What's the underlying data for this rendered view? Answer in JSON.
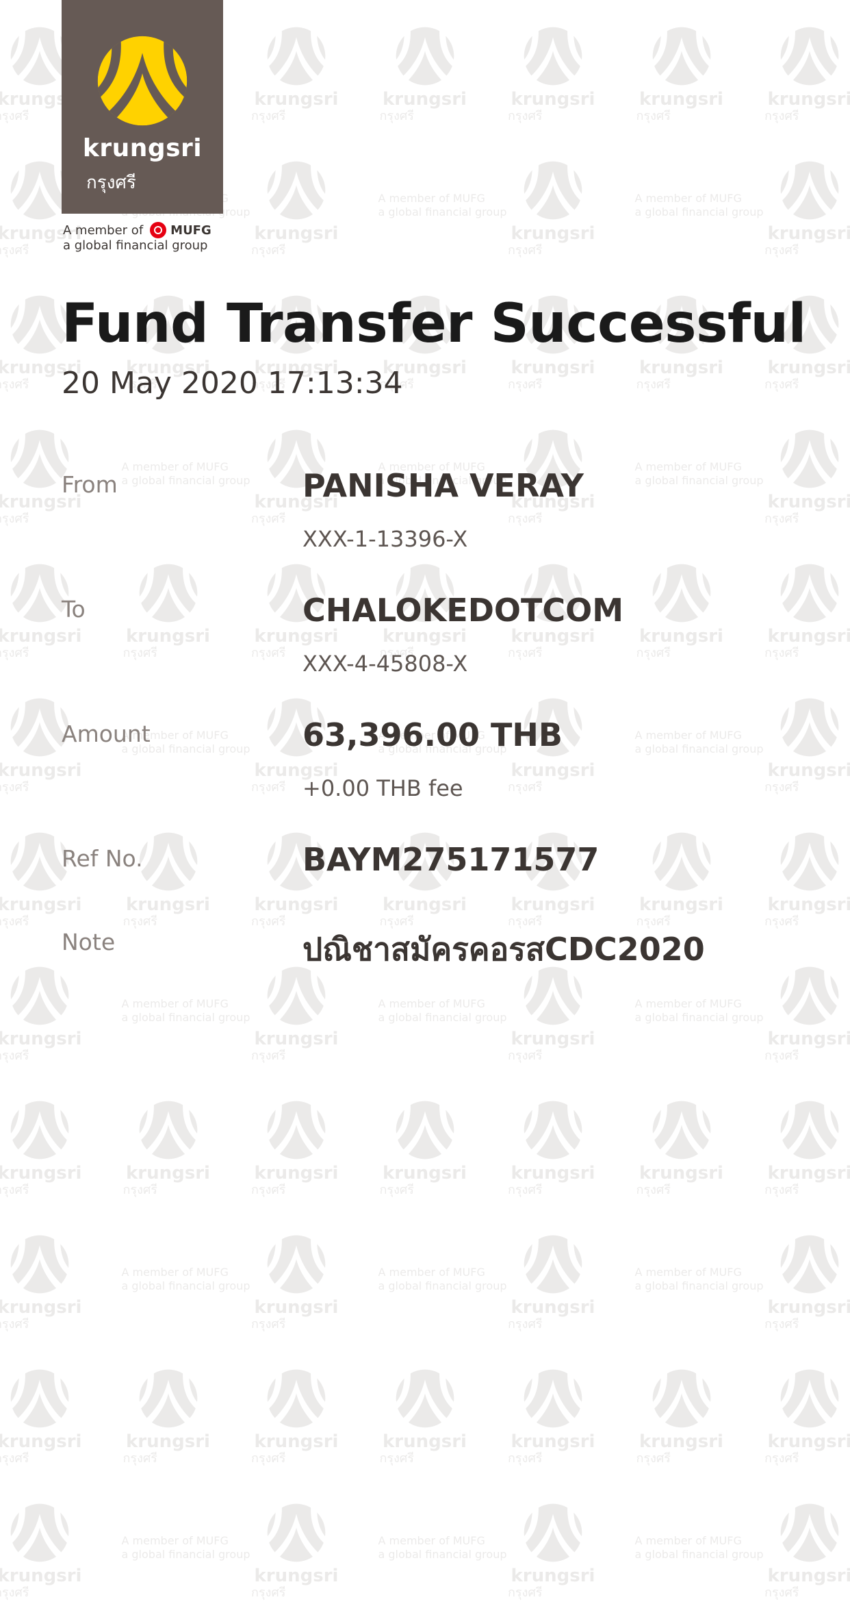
{
  "logo": {
    "brand": "krungsri",
    "brand_thai": "กรุงศรี",
    "member_prefix": "A member of",
    "member_mufg": "MUFG",
    "member_group": "a global financial group",
    "icon": "krungsri-logo-icon",
    "color": "#665a55",
    "accent": "#ffd200"
  },
  "receipt": {
    "title": "Fund Transfer Successful",
    "timestamp": "20 May 2020 17:13:34",
    "from": {
      "label": "From",
      "name": "PANISHA VERAY",
      "account": "XXX-1-13396-X"
    },
    "to": {
      "label": "To",
      "name": "CHALOKEDOTCOM",
      "account": "XXX-4-45808-X"
    },
    "amount": {
      "label": "Amount",
      "value": "63,396.00 THB",
      "fee": "+0.00 THB fee"
    },
    "ref": {
      "label": "Ref No.",
      "value": "BAYM275171577"
    },
    "note": {
      "label": "Note",
      "value": "ปณิชาสมัครคอรสCDC2020"
    }
  },
  "watermark": {
    "brand": "krungsri",
    "brand_thai": "กรุงศรี",
    "member_line1": "A member of MUFG",
    "member_line2": "a global financial group",
    "icon": "krungsri-logo-icon"
  }
}
